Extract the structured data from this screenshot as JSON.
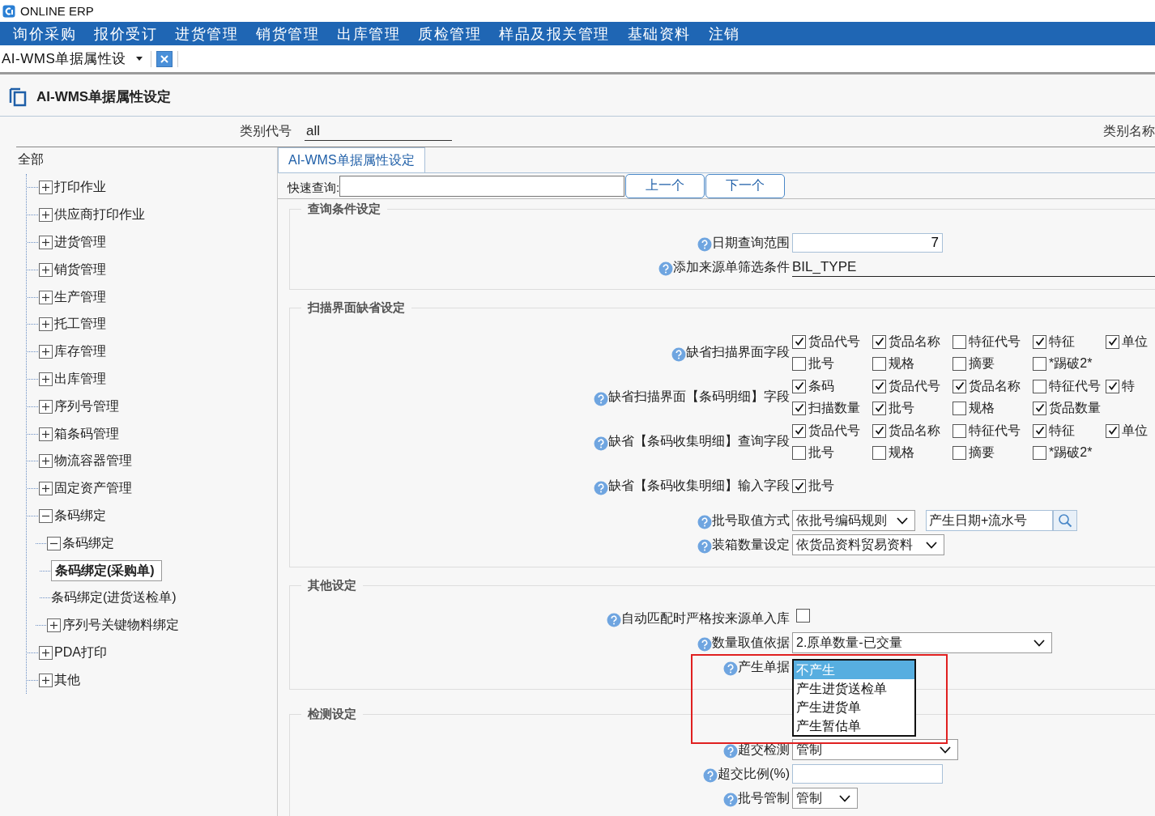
{
  "app": {
    "title": "ONLINE ERP"
  },
  "menu": [
    "询价采购",
    "报价受订",
    "进货管理",
    "销货管理",
    "出库管理",
    "质检管理",
    "样品及报关管理",
    "基础资料",
    "注销"
  ],
  "doc_tab": {
    "label": "AI-WMS单据属性设"
  },
  "page_title": "AI-WMS单据属性设定",
  "filter": {
    "code_label": "类别代号",
    "code_value": "all",
    "name_label": "类别名称"
  },
  "tree": {
    "label": "全部",
    "children": [
      {
        "label": "打印作业",
        "expanded": false,
        "selected": false
      },
      {
        "label": "供应商打印作业",
        "expanded": false,
        "selected": false
      },
      {
        "label": "进货管理",
        "expanded": false,
        "selected": false
      },
      {
        "label": "销货管理",
        "expanded": false,
        "selected": false
      },
      {
        "label": "生产管理",
        "expanded": false,
        "selected": false
      },
      {
        "label": "托工管理",
        "expanded": false,
        "selected": false
      },
      {
        "label": "库存管理",
        "expanded": false,
        "selected": false
      },
      {
        "label": "出库管理",
        "expanded": false,
        "selected": false
      },
      {
        "label": "序列号管理",
        "expanded": false,
        "selected": false
      },
      {
        "label": "箱条码管理",
        "expanded": false,
        "selected": false
      },
      {
        "label": "物流容器管理",
        "expanded": false,
        "selected": false
      },
      {
        "label": "固定资产管理",
        "expanded": false,
        "selected": false
      },
      {
        "label": "条码绑定",
        "expanded": true,
        "selected": false,
        "children": [
          {
            "label": "条码绑定",
            "expanded": true,
            "selected": false,
            "children": [
              {
                "label": "条码绑定(采购单)",
                "selected": true
              },
              {
                "label": "条码绑定(进货送检单)",
                "selected": false
              }
            ]
          },
          {
            "label": "序列号关键物料绑定",
            "expanded": false,
            "selected": false
          }
        ]
      },
      {
        "label": "PDA打印",
        "expanded": false,
        "selected": false
      },
      {
        "label": "其他",
        "expanded": false,
        "selected": false
      }
    ]
  },
  "panel_tab": {
    "label": "AI-WMS单据属性设定"
  },
  "quick_search": {
    "label": "快速查询:",
    "prev": "上一个",
    "next": "下一个"
  },
  "sections": [
    {
      "title": "查询条件设定",
      "rows": [
        {
          "kind": "input",
          "label": "日期查询范围",
          "value": "7"
        },
        {
          "kind": "underline",
          "label": "添加来源单筛选条件",
          "value": "BIL_TYPE"
        }
      ]
    },
    {
      "title": "扫描界面缺省设定",
      "rows": [
        {
          "kind": "checkboxes",
          "label": "缺省扫描界面字段",
          "lines": [
            [
              {
                "label": "货品代号",
                "checked": true
              },
              {
                "label": "货品名称",
                "checked": true
              },
              {
                "label": "特征代号",
                "checked": false
              },
              {
                "label": "特征",
                "checked": true
              },
              {
                "label": "单位",
                "checked": true
              }
            ],
            [
              {
                "label": "批号",
                "checked": false
              },
              {
                "label": "规格",
                "checked": false
              },
              {
                "label": "摘要",
                "checked": false
              },
              {
                "label": "*踢破2*",
                "checked": false
              }
            ]
          ]
        },
        {
          "kind": "checkboxes",
          "label": "缺省扫描界面【条码明细】字段",
          "lines": [
            [
              {
                "label": "条码",
                "checked": true
              },
              {
                "label": "货品代号",
                "checked": true
              },
              {
                "label": "货品名称",
                "checked": true
              },
              {
                "label": "特征代号",
                "checked": false
              },
              {
                "label": "特",
                "checked": true
              }
            ],
            [
              {
                "label": "扫描数量",
                "checked": true
              },
              {
                "label": "批号",
                "checked": true
              },
              {
                "label": "规格",
                "checked": false
              },
              {
                "label": "货品数量",
                "checked": true
              }
            ]
          ]
        },
        {
          "kind": "checkboxes",
          "label": "缺省【条码收集明细】查询字段",
          "lines": [
            [
              {
                "label": "货品代号",
                "checked": true
              },
              {
                "label": "货品名称",
                "checked": true
              },
              {
                "label": "特征代号",
                "checked": false
              },
              {
                "label": "特征",
                "checked": true
              },
              {
                "label": "单位",
                "checked": true
              }
            ],
            [
              {
                "label": "批号",
                "checked": false
              },
              {
                "label": "规格",
                "checked": false
              },
              {
                "label": "摘要",
                "checked": false
              },
              {
                "label": "*踢破2*",
                "checked": false
              }
            ]
          ]
        },
        {
          "kind": "checkboxes",
          "label": "缺省【条码收集明细】输入字段",
          "lines": [
            [
              {
                "label": "批号",
                "checked": true
              }
            ]
          ]
        },
        {
          "kind": "lookup",
          "label": "批号取值方式",
          "value": "依批号编码规则",
          "lookup": "产生日期+流水号"
        },
        {
          "kind": "select",
          "label": "装箱数量设定",
          "value": "依货品资料贸易资料"
        }
      ]
    },
    {
      "title": "其他设定",
      "rows": [
        {
          "kind": "checkbox",
          "label": "自动匹配时严格按来源单入库",
          "checked": false
        },
        {
          "kind": "select",
          "label": "数量取值依据",
          "value": "2.原单数量-已交量"
        },
        {
          "kind": "dropdown",
          "label": "产生单据",
          "options": [
            {
              "label": "不产生",
              "selected": true
            },
            {
              "label": "产生进货送检单",
              "selected": false
            },
            {
              "label": "产生进货单",
              "selected": false
            },
            {
              "label": "产生暂估单",
              "selected": false
            }
          ]
        }
      ]
    },
    {
      "title": "检测设定",
      "rows": [
        {
          "kind": "select",
          "label": "超交检测",
          "value": "管制"
        },
        {
          "kind": "input",
          "label": "超交比例(%)"
        },
        {
          "kind": "select",
          "label": "批号管制",
          "value": "管制"
        }
      ]
    }
  ]
}
